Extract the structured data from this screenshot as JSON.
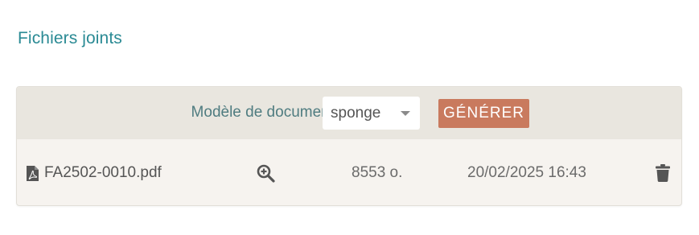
{
  "section": {
    "title": "Fichiers joints"
  },
  "toolbar": {
    "model_label": "Modèle de document",
    "model_select": {
      "selected": "sponge"
    },
    "generate_label": "GÉNÉRER"
  },
  "files": [
    {
      "name": "FA2502-0010.pdf",
      "size": "8553 o.",
      "date": "20/02/2025 16:43",
      "icons": {
        "type": "file-pdf-icon",
        "preview": "zoom-in-icon",
        "delete": "trash-icon"
      }
    }
  ],
  "colors": {
    "title": "#2a8a94",
    "label": "#4f7c80",
    "generate_button": "#c97a5e",
    "toolbar_bg": "#e9e6df",
    "row_bg": "#f6f3ef",
    "icon": "#555555"
  }
}
